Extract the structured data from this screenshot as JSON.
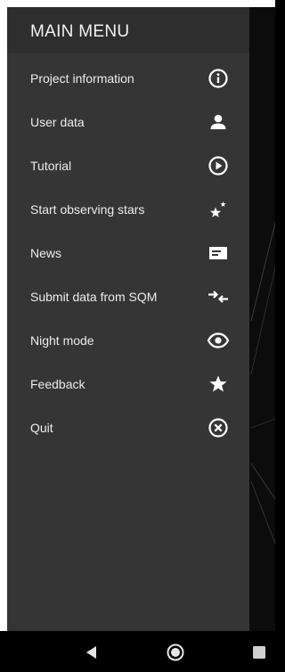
{
  "drawer": {
    "title": "MAIN MENU",
    "items": [
      {
        "label": "Project information",
        "icon": "info-icon"
      },
      {
        "label": "User data",
        "icon": "person-icon"
      },
      {
        "label": "Tutorial",
        "icon": "play-icon"
      },
      {
        "label": "Start observing stars",
        "icon": "stars-icon"
      },
      {
        "label": "News",
        "icon": "news-icon"
      },
      {
        "label": "Submit data from SQM",
        "icon": "transfer-icon"
      },
      {
        "label": "Night mode",
        "icon": "eye-icon"
      },
      {
        "label": "Feedback",
        "icon": "star-icon"
      },
      {
        "label": "Quit",
        "icon": "close-circle-icon"
      }
    ]
  },
  "navbar": {
    "buttons": [
      "back-icon",
      "home-icon",
      "recents-icon"
    ]
  },
  "colors": {
    "drawer_bg": "#353535",
    "header_bg": "#2e2e2e",
    "text": "#ececec",
    "icon": "#ffffff"
  }
}
